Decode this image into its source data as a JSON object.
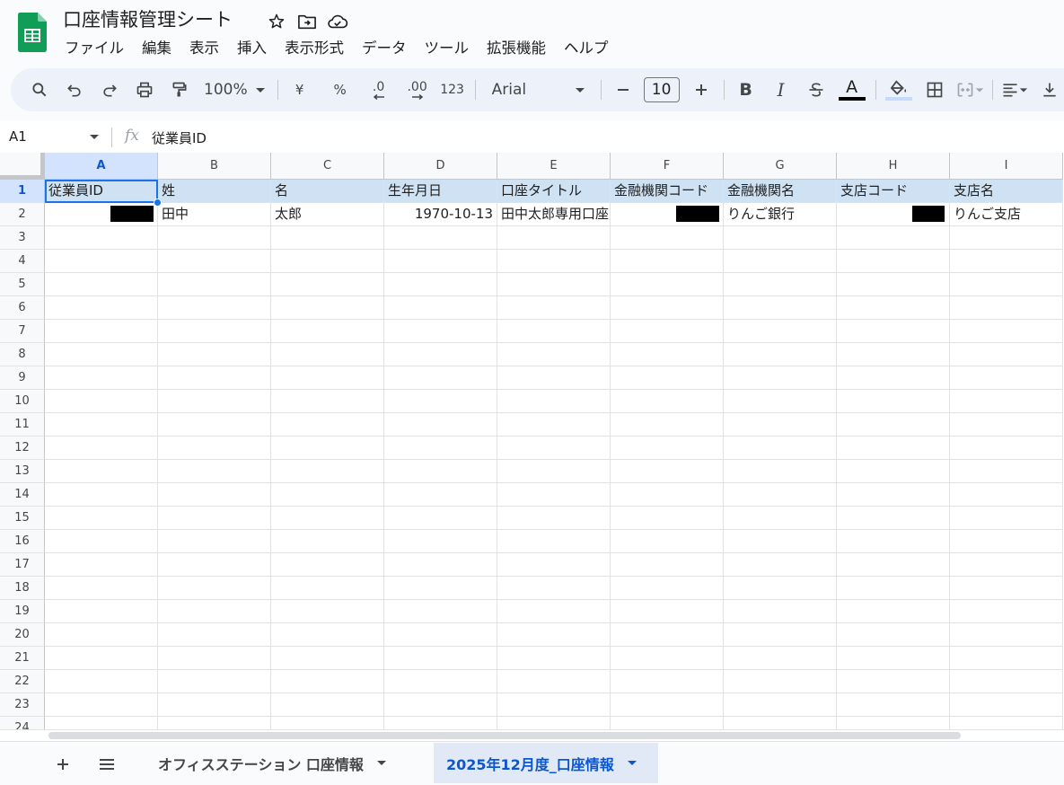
{
  "document": {
    "title": "口座情報管理シート",
    "icons": [
      "star-icon",
      "move-to-folder-icon",
      "cloud-saved-icon"
    ]
  },
  "menu": [
    "ファイル",
    "編集",
    "表示",
    "挿入",
    "表示形式",
    "データ",
    "ツール",
    "拡張機能",
    "ヘルプ"
  ],
  "toolbar": {
    "zoom": "100%",
    "currency_label": "¥",
    "percent_label": "%",
    "decrease_decimal_label": ".0",
    "increase_decimal_label": ".00",
    "number_format_label": "123",
    "font": "Arial",
    "font_size": "10",
    "bold_label": "B",
    "italic_label": "I",
    "text_color_label": "A",
    "colors": {
      "text_color_bar": "#000000",
      "fill_color_bar": "#c6dafc"
    }
  },
  "formula_bar": {
    "cell_ref": "A1",
    "fx_label": "fx",
    "content": "従業員ID"
  },
  "grid": {
    "columns": [
      "A",
      "B",
      "C",
      "D",
      "E",
      "F",
      "G",
      "H",
      "I"
    ],
    "selected_column": "A",
    "selected_row": "1",
    "rows": [
      "1",
      "2",
      "3",
      "4",
      "5",
      "6",
      "7",
      "8",
      "9",
      "10",
      "11",
      "12",
      "13",
      "14",
      "15",
      "16",
      "17",
      "18",
      "19",
      "20",
      "21",
      "22",
      "23",
      "24"
    ],
    "header_row": [
      "従業員ID",
      "姓",
      "名",
      "生年月日",
      "口座タイトル",
      "金融機関コード",
      "金融機関名",
      "支店コード",
      "支店名"
    ],
    "data_rows": [
      [
        "",
        "田中",
        "太郎",
        "1970-10-13",
        "田中太郎専用口座",
        "",
        "りんご銀行",
        "",
        "りんご支店"
      ]
    ],
    "colors": {
      "header_fill": "#cfe2f3",
      "selection": "#1a73e8"
    }
  },
  "sheets": {
    "tabs": [
      {
        "label": "オフィスステーション 口座情報",
        "active": false
      },
      {
        "label": "2025年12月度_口座情報",
        "active": true
      }
    ]
  }
}
